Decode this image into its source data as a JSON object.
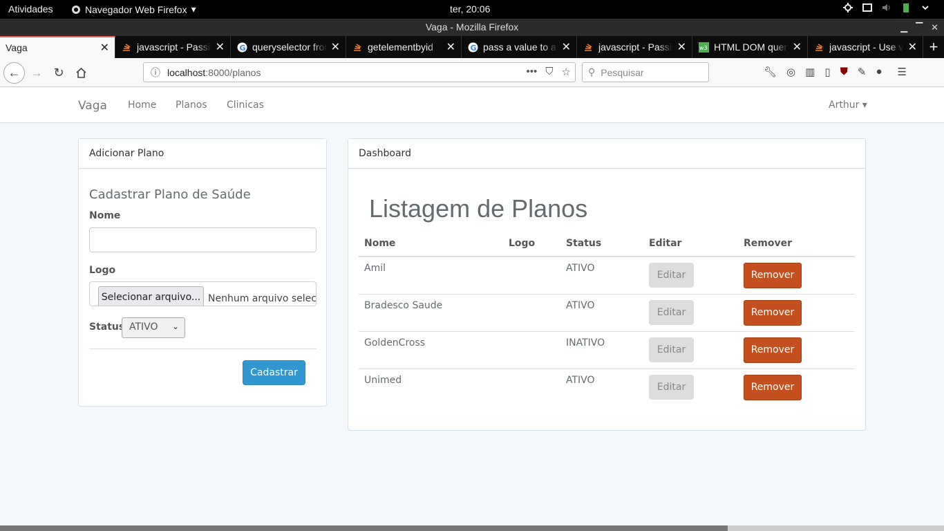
{
  "gnome": {
    "activities": "Atividades",
    "app_menu": "Navegador Web Firefox",
    "clock": "ter, 20:06",
    "icons": [
      "crosshair-icon",
      "screen-icon",
      "volume-icon",
      "battery-icon",
      "power-menu-icon"
    ]
  },
  "window": {
    "title": "Vaga - Mozilla Firefox",
    "controls": [
      "minimize-icon",
      "maximize-icon",
      "close-icon"
    ]
  },
  "tabs": [
    {
      "title": "Vaga",
      "favicon": "none",
      "active": true
    },
    {
      "title": "javascript - Passing",
      "favicon": "stackoverflow-icon"
    },
    {
      "title": "queryselector from",
      "favicon": "google-icon"
    },
    {
      "title": "getelementbyid",
      "favicon": "stackoverflow-icon"
    },
    {
      "title": "pass a value to a",
      "favicon": "google-icon"
    },
    {
      "title": "javascript - Passing",
      "favicon": "stackoverflow-icon"
    },
    {
      "title": "HTML DOM query",
      "favicon": "w3schools-icon"
    },
    {
      "title": "javascript - Use v",
      "favicon": "stackoverflow-icon"
    }
  ],
  "toolbar": {
    "url_host": "localhost",
    "url_path": ":8000/planos",
    "search_placeholder": "Pesquisar"
  },
  "site": {
    "brand": "Vaga",
    "links": [
      "Home",
      "Planos",
      "Clinicas"
    ],
    "user": "Arthur"
  },
  "add_panel": {
    "heading": "Adicionar Plano",
    "form_title": "Cadastrar Plano de Saúde",
    "name_label": "Nome",
    "name_value": "",
    "logo_label": "Logo",
    "file_button": "Selecionar arquivo...",
    "file_none": "Nenhum arquivo selecionado.",
    "status_label": "Status",
    "status_value": "ATIVO",
    "submit": "Cadastrar"
  },
  "dashboard": {
    "heading": "Dashboard",
    "title": "Listagem de Planos",
    "columns": [
      "Nome",
      "Logo",
      "Status",
      "Editar",
      "Remover"
    ],
    "rows": [
      {
        "nome": "Amil",
        "logo": "",
        "status": "ATIVO",
        "edit": "Editar",
        "remove": "Remover"
      },
      {
        "nome": "Bradesco Saude",
        "logo": "",
        "status": "ATIVO",
        "edit": "Editar",
        "remove": "Remover"
      },
      {
        "nome": "GoldenCross",
        "logo": "",
        "status": "INATIVO",
        "edit": "Editar",
        "remove": "Remover"
      },
      {
        "nome": "Unimed",
        "logo": "",
        "status": "ATIVO",
        "edit": "Editar",
        "remove": "Remover"
      }
    ]
  },
  "colors": {
    "primary": "#3097d1",
    "danger": "#c4501f",
    "page_bg": "#f5f8fa"
  }
}
